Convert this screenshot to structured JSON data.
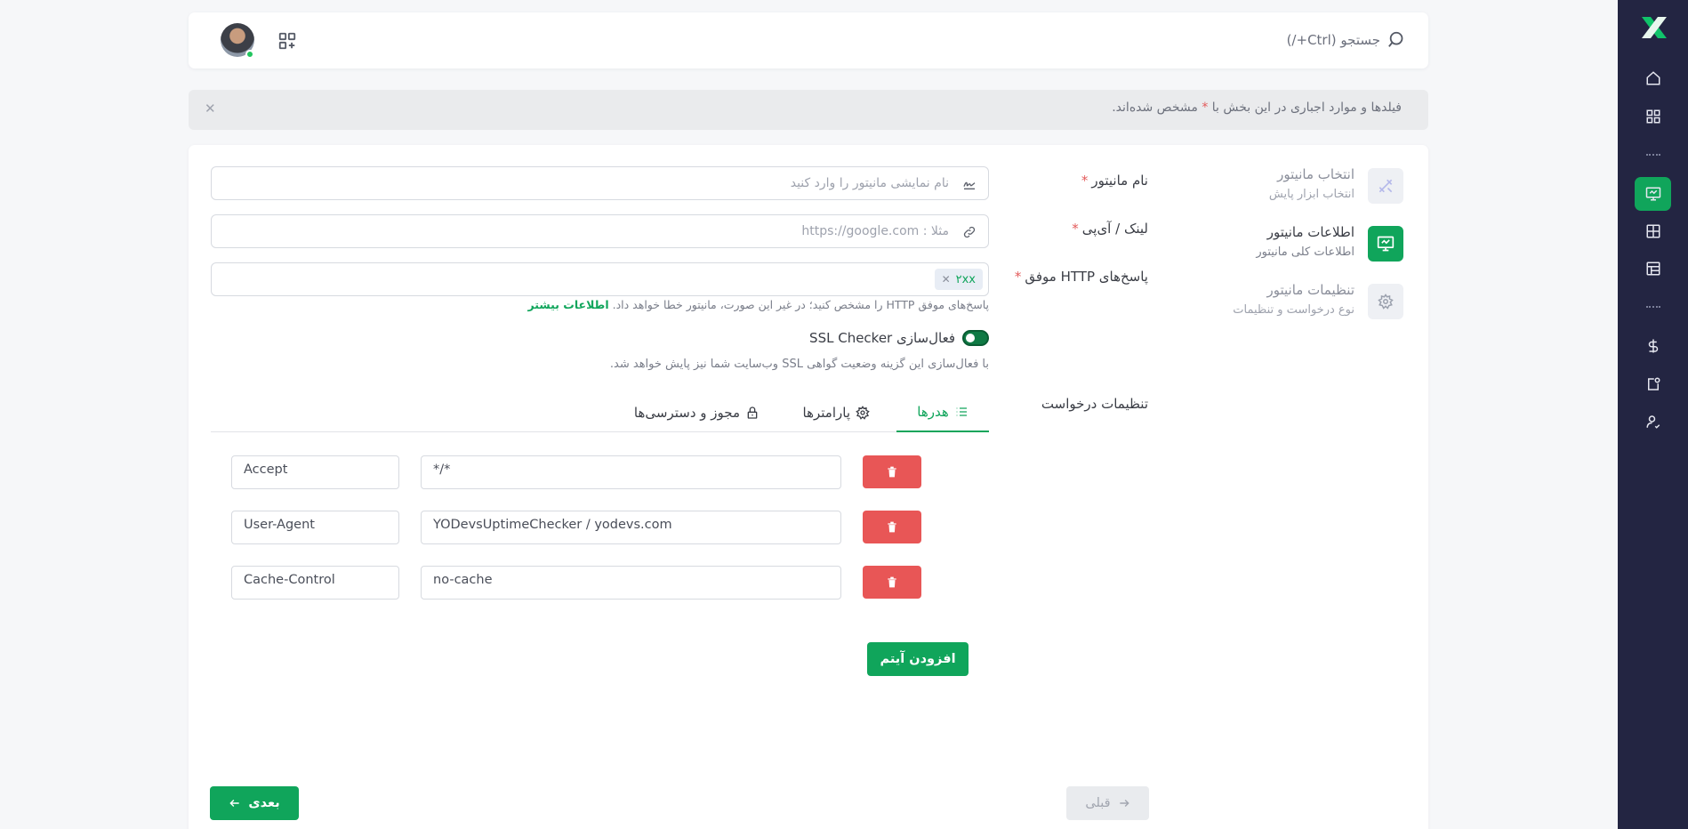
{
  "header": {
    "search_placeholder": "جستجو (Ctrl+/)"
  },
  "alert": {
    "text_before": "فیلدها و موارد اجباری در این بخش با",
    "star": "*",
    "text_after": "مشخص شده‌اند."
  },
  "steps": [
    {
      "title": "انتخاب مانیتور",
      "subtitle": "انتخاب ابزار پایش",
      "icon": "tools-icon"
    },
    {
      "title": "اطلاعات مانیتور",
      "subtitle": "اطلاعات کلی مانیتور",
      "icon": "monitor-icon"
    },
    {
      "title": "تنظیمات مانیتور",
      "subtitle": "نوع درخواست و تنظیمات",
      "icon": "gear-icon"
    }
  ],
  "form": {
    "name_label": "نام مانیتور",
    "name_placeholder": "نام نمایشی مانیتور را وارد کنید",
    "url_label": "لینک / آی‌پی",
    "url_placeholder": "مثلا : https://google.com",
    "http_label": "پاسخ‌های HTTP موفق",
    "http_chip": "۲xx",
    "required_star": "*",
    "http_help": "پاسخ‌های موفق HTTP را مشخص کنید؛ در غیر این صورت، مانیتور خطا خواهد داد.",
    "http_help_link": "اطلاعات بیشتر",
    "ssl_label": "فعال‌سازی SSL Checker",
    "ssl_enabled": true,
    "ssl_help": "با فعال‌سازی این گزینه وضعیت گواهی SSL وب‌سایت شما نیز پایش خواهد شد.",
    "request_settings_label": "تنظیمات درخواست"
  },
  "tabs": [
    {
      "label": "هدرها",
      "active": true
    },
    {
      "label": "پارامترها",
      "active": false
    },
    {
      "label": "مجوز و دسترسی‌ها",
      "active": false
    }
  ],
  "headers": [
    {
      "key": "Accept",
      "value": "*/*"
    },
    {
      "key": "User-Agent",
      "value": "YODevsUptimeChecker / yodevs.com"
    },
    {
      "key": "Cache-Control",
      "value": "no-cache"
    }
  ],
  "buttons": {
    "add_item": "افزودن آیتم",
    "next": "بعدی",
    "prev": "قبلی"
  },
  "colors": {
    "accent": "#10a55b",
    "sidebar": "#232542",
    "danger": "#e85656"
  }
}
